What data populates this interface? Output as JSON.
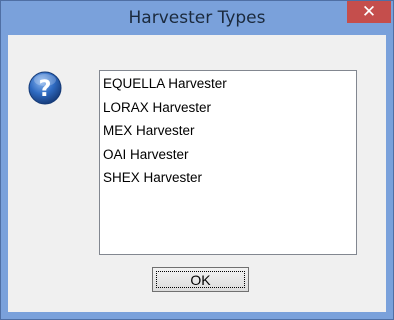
{
  "window": {
    "title": "Harvester Types",
    "close_label": "✕"
  },
  "icon": "question-icon",
  "list": {
    "items": [
      {
        "label": "EQUELLA Harvester"
      },
      {
        "label": "LORAX Harvester"
      },
      {
        "label": "MEX Harvester"
      },
      {
        "label": "OAI Harvester"
      },
      {
        "label": "SHEX Harvester"
      }
    ]
  },
  "buttons": {
    "ok_label": "OK"
  },
  "colors": {
    "titlebar": "#7aa1db",
    "close": "#c54e4c",
    "dialog_body": "#f0f0f0"
  }
}
